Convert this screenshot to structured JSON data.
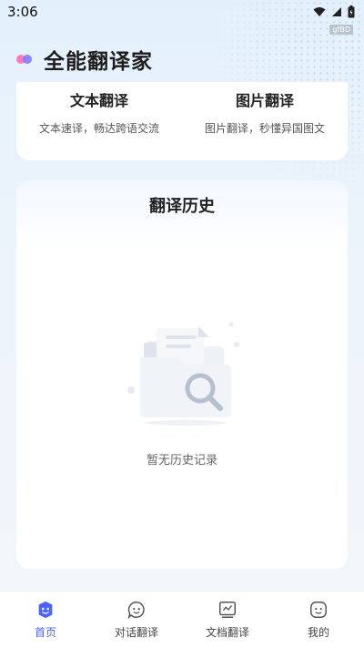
{
  "status_bar": {
    "time": "3:06",
    "speed": "gfBD"
  },
  "app": {
    "title": "全能翻译家"
  },
  "features": [
    {
      "title": "文本翻译",
      "desc": "文本速译，畅达跨语交流"
    },
    {
      "title": "图片翻译",
      "desc": "图片翻译，秒懂异国图文"
    }
  ],
  "history": {
    "title": "翻译历史",
    "empty_text": "暂无历史记录"
  },
  "tabs": [
    {
      "label": "首页",
      "icon": "home-face-icon",
      "active": true
    },
    {
      "label": "对话翻译",
      "icon": "chat-icon",
      "active": false
    },
    {
      "label": "文档翻译",
      "icon": "document-chart-icon",
      "active": false
    },
    {
      "label": "我的",
      "icon": "profile-face-icon",
      "active": false
    }
  ],
  "colors": {
    "accent": "#4a63ff",
    "logo_pink": "#ff7bbf",
    "logo_purple": "#7f7bff"
  }
}
